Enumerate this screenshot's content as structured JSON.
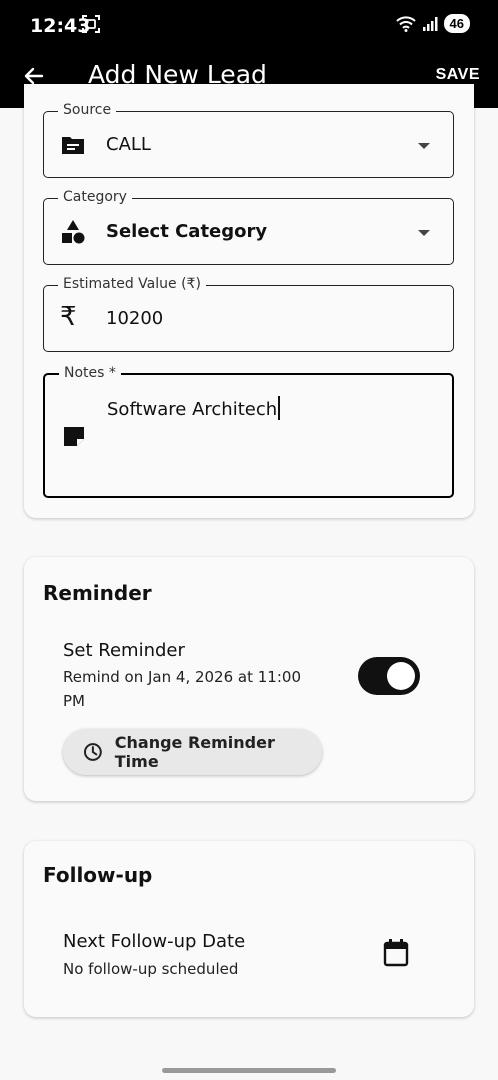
{
  "status_bar": {
    "time": "12:43",
    "battery": "46"
  },
  "app_bar": {
    "title": "Add New Lead",
    "save_label": "SAVE"
  },
  "form": {
    "source": {
      "label": "Source",
      "value": "CALL"
    },
    "category": {
      "label": "Category",
      "value": "Select Category"
    },
    "estimated_value": {
      "label": "Estimated Value (₹)",
      "value": "10200",
      "currency_symbol": "₹"
    },
    "notes": {
      "label": "Notes *",
      "value": "Software Architech"
    }
  },
  "reminder": {
    "title": "Reminder",
    "set_label": "Set Reminder",
    "remind_line1": "Remind on Jan 4, 2026 at 11:00",
    "remind_line2": "PM",
    "enabled": true,
    "change_button_label": "Change Reminder Time"
  },
  "follow_up": {
    "title": "Follow-up",
    "next_label": "Next Follow-up Date",
    "status": "No follow-up scheduled"
  },
  "icons": {
    "source": "document-list-icon",
    "category": "shapes-icon",
    "value": "rupee-icon",
    "notes": "note-icon",
    "dropdown": "dropdown-arrow-icon",
    "clock": "clock-icon",
    "calendar": "calendar-icon",
    "back": "back-arrow-icon"
  },
  "colors": {
    "accent": "#111111",
    "background": "#f8f8f8",
    "app_bar": "#000000"
  }
}
